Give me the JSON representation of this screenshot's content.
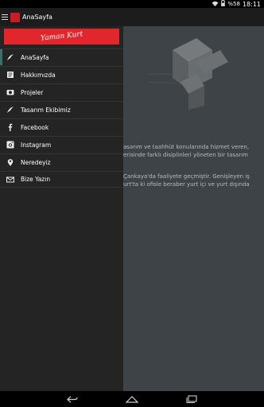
{
  "status": {
    "battery": "%58",
    "time": "18:11"
  },
  "app": {
    "title": "AnaSayfa"
  },
  "drawer": {
    "logo_text": "Yaman Kurt",
    "items": [
      {
        "label": "AnaSayfa",
        "icon": "feather-icon"
      },
      {
        "label": "Hakkımızda",
        "icon": "document-icon"
      },
      {
        "label": "Projeler",
        "icon": "camera-icon"
      },
      {
        "label": "Tasarım Ekibimiz",
        "icon": "feather-icon"
      },
      {
        "label": "Facebook",
        "icon": "facebook-icon"
      },
      {
        "label": "Instagram",
        "icon": "instagram-icon"
      },
      {
        "label": "Neredeyiz",
        "icon": "location-pin-icon"
      },
      {
        "label": "Bize Yazın",
        "icon": "mail-icon"
      }
    ]
  },
  "content": {
    "lines": [
      "asarım ve taahhüt konularında hizmet veren,",
      "erisinde farklı disiplinleri yöneten bir tasarım",
      "",
      "Çankaya'da faaliyete geçmiştir. Genişleyen iş",
      "urt'ta ki ofisle beraber yurt içi ve yurt dışında"
    ]
  }
}
